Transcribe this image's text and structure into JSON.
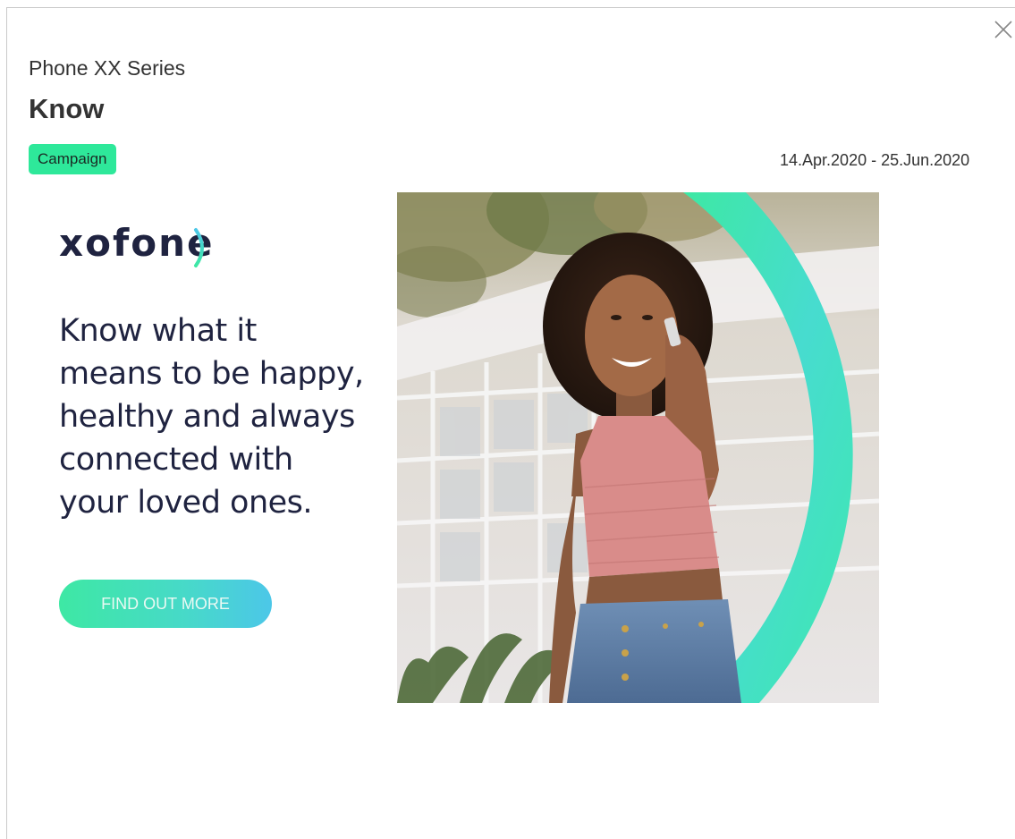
{
  "dialog": {
    "close_icon": "close-icon",
    "series": "Phone XX Series",
    "title": "Know",
    "badge": "Campaign",
    "date_range": "14.Apr.2020 - 25.Jun.2020"
  },
  "ad": {
    "logo_text": "xofone",
    "tagline_lines": [
      "Know what it",
      "means to be happy,",
      "healthy and always",
      "connected with",
      "your loved ones."
    ],
    "cta_label": "FIND OUT MORE",
    "photo_icon": "smiling-woman-on-phone-photo"
  },
  "colors": {
    "badge": "#2ee89a",
    "brand_navy": "#1f2340",
    "accent_green": "#3ee8a4",
    "accent_cyan": "#4cc7e8"
  }
}
